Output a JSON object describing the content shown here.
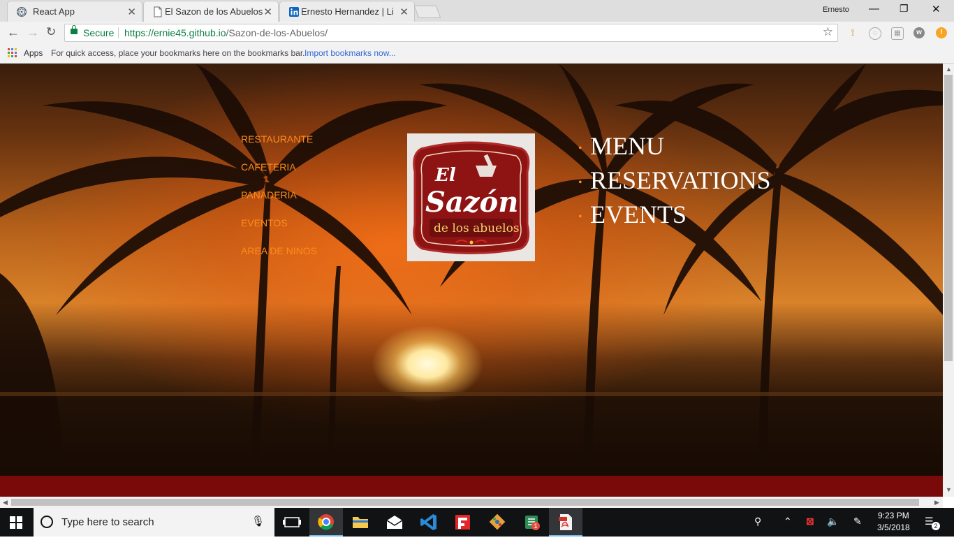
{
  "browser": {
    "tabs": [
      {
        "title": "React App",
        "icon": "react-icon",
        "active": false
      },
      {
        "title": "El Sazon de los Abuelos",
        "icon": "page-icon",
        "active": true
      },
      {
        "title": "Ernesto Hernandez | Link",
        "icon": "linkedin-icon",
        "active": false
      }
    ],
    "profile_name": "Ernesto",
    "security_label": "Secure",
    "url_host": "https://ernie45.github.io",
    "url_path": "/Sazon-de-los-Abuelos/",
    "bookmarks": {
      "apps_label": "Apps",
      "hint": "For quick access, place your bookmarks here on the bookmarks bar.",
      "import_link": "Import bookmarks now..."
    }
  },
  "page": {
    "left_nav": [
      "RESTAURANTE",
      "CAFETERIA",
      "PANADERIA",
      "EVENTOS",
      "AREA DE NINOS"
    ],
    "logo": {
      "line1": "El",
      "line2": "Sazón",
      "line3": "de los abuelos"
    },
    "right_nav": [
      "MENU",
      "RESERVATIONS",
      "EVENTS"
    ],
    "colors": {
      "accent": "#ff8c1a",
      "footer": "#7a0a0a",
      "logo_red": "#8e1414"
    }
  },
  "taskbar": {
    "search_placeholder": "Type here to search",
    "apps": [
      "task-view-icon",
      "chrome-icon",
      "file-explorer-icon",
      "mail-icon",
      "vscode-icon",
      "flipboard-icon",
      "git-icon",
      "sticky-app-icon",
      "pdf-icon"
    ],
    "time": "9:23 PM",
    "date": "3/5/2018",
    "notification_count": "2",
    "app_badge": "1"
  }
}
